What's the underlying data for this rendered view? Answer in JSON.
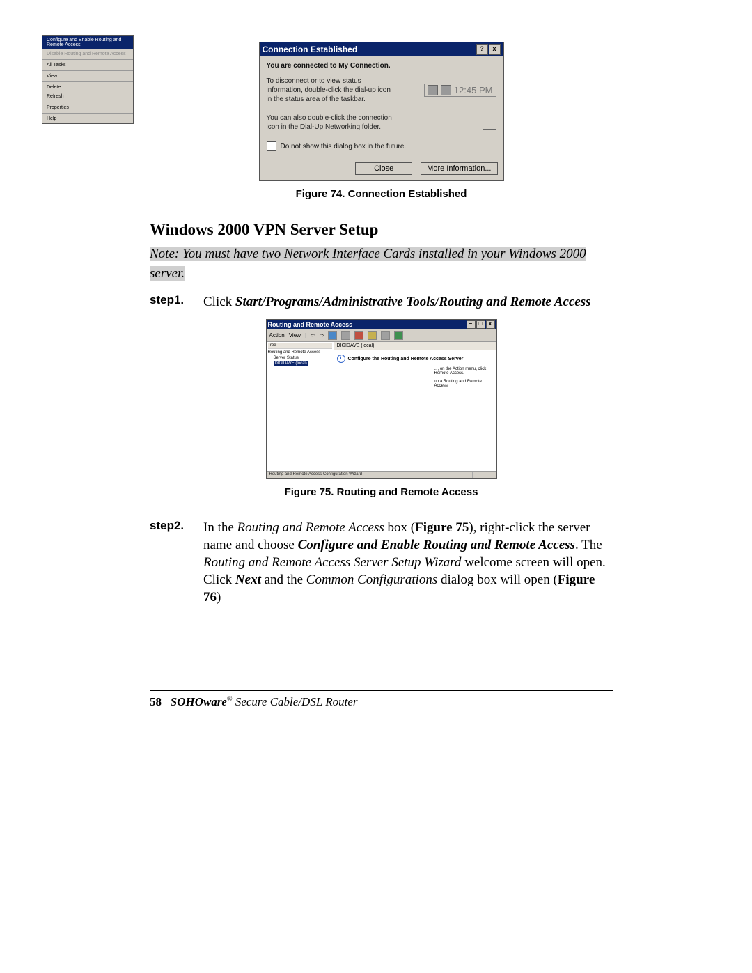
{
  "figure1": {
    "dialog_title": "Connection Established",
    "connected_text": "You are connected to My Connection.",
    "disconnect_text": "To disconnect or to view status information, double-click the dial-up icon in the status area of the taskbar.",
    "tray_time": "12:45 PM",
    "dun_text": "You can also double-click the connection icon in the Dial-Up Networking folder.",
    "checkbox_text": "Do not show this dialog box in the future.",
    "close_btn": "Close",
    "more_btn": "More Information...",
    "help_btn": "?",
    "x_btn": "x",
    "caption": "Figure 74. Connection Established"
  },
  "section_title": "Windows 2000 VPN Server Setup",
  "note_text": "Note:  You must have two Network Interface Cards installed in your Windows 2000 server.",
  "step1": {
    "label": "step1.",
    "pre": "Click ",
    "bold_italic": "Start/Programs/Administrative Tools/Routing and Remote Access"
  },
  "figure2": {
    "window_title": "Routing and Remote Access",
    "menu_action": "Action",
    "menu_view": "View",
    "arrow_l": "⇦",
    "arrow_r": "⇨",
    "tree_label": "Tree",
    "tree_root": "Routing and Remote Access",
    "tree_item1": "Server Status",
    "tree_item2": "DIGIDAVE (local)",
    "right_header": "DIGIDAVE (local)",
    "config_title": "Configure the Routing and Remote Access Server",
    "hint1": "..., on the Action menu, click",
    "hint2": "Remote Access.",
    "hint3": "up a Routing and Remote Access",
    "ctx_config": "Configure and Enable Routing and Remote Access",
    "ctx_disable": "Disable Routing and Remote Access",
    "ctx_alltasks": "All Tasks",
    "ctx_view": "View",
    "ctx_delete": "Delete",
    "ctx_refresh": "Refresh",
    "ctx_properties": "Properties",
    "ctx_help": "Help",
    "status_text": "Routing and Remote Access Configuration Wizard",
    "min_btn": "–",
    "max_btn": "□",
    "x_btn": "x",
    "caption": "Figure 75. Routing and Remote Access"
  },
  "step2": {
    "label": "step2.",
    "t1": "In the ",
    "it1": "Routing and Remote Access",
    "t2": " box (",
    "b1": "Figure 75",
    "t3": "), right-click the server name and choose ",
    "bi1": "Configure and Enable Routing and Remote Access",
    "t4": ".  The ",
    "it2": "Routing and Remote Access Server Setup Wizard",
    "t5": " welcome screen will open.  Click ",
    "bi2": "Next",
    "t6": " and the ",
    "it3": "Common Configurations",
    "t7": " dialog box will open (",
    "b2": "Figure 76",
    "t8": ")"
  },
  "footer": {
    "page_num": "58",
    "brand1": "SOHOware",
    "reg": "®",
    "brand2": " Secure Cable/DSL Router"
  }
}
